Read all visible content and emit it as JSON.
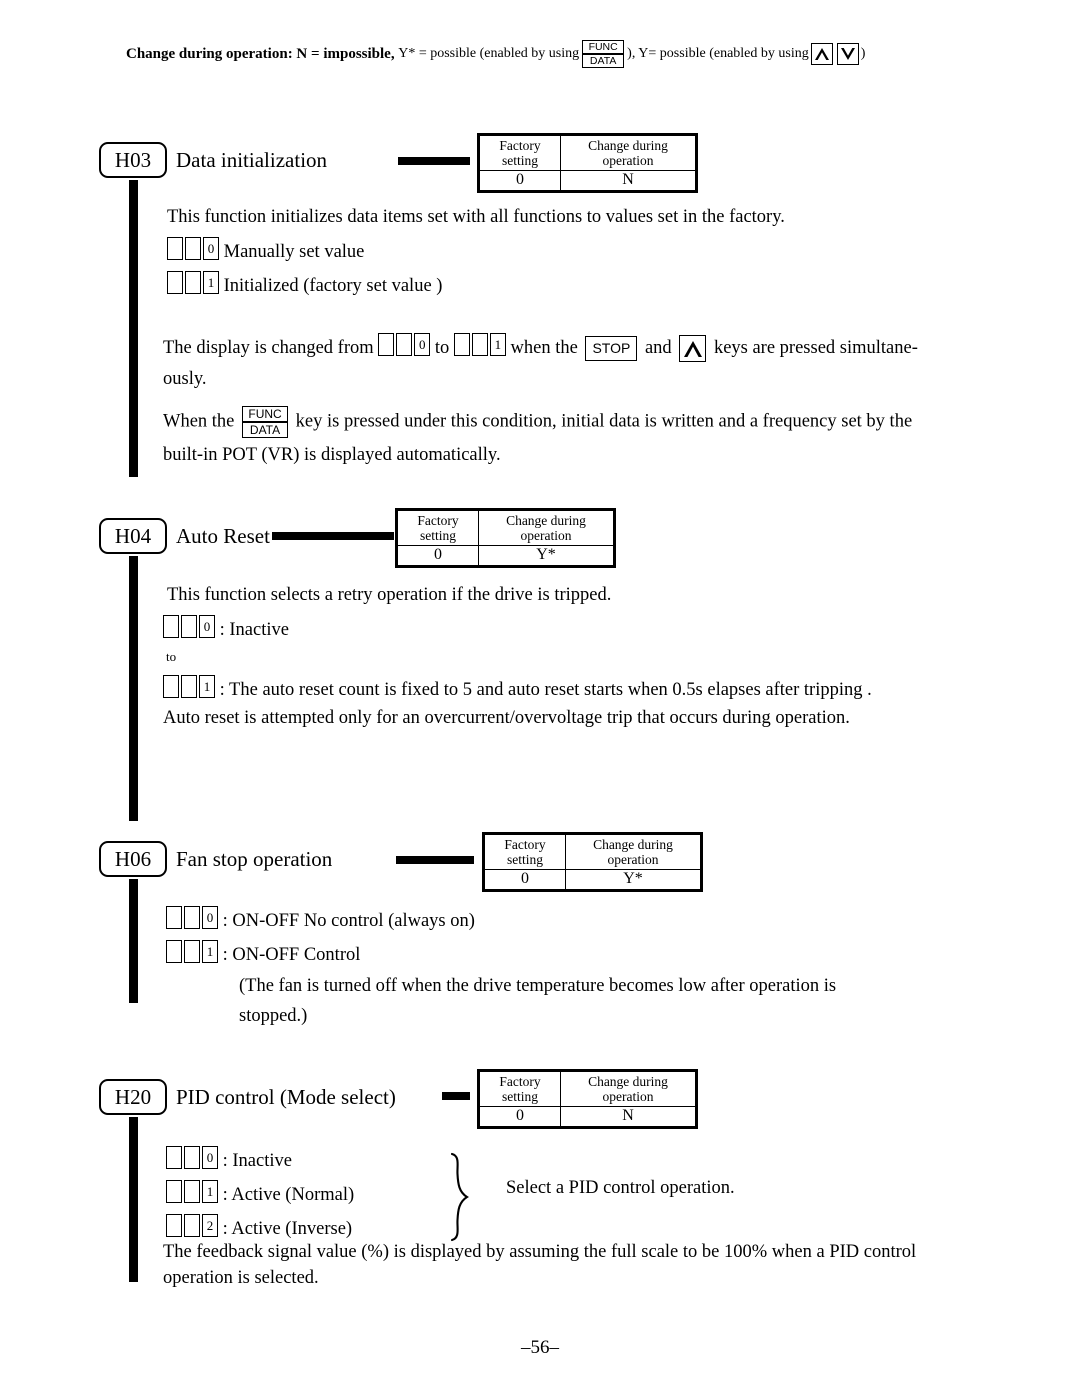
{
  "header": {
    "prefix_bold": "Change during operation: N = impossible,",
    "y_star_text": "Y* = possible (enabled by using",
    "func_key_top": "FUNC",
    "func_key_bottom": "DATA",
    "mid_text": "), Y= possible (enabled by using",
    "close_paren": ")"
  },
  "sections": [
    {
      "code": "H03",
      "title": "Data initialization",
      "table": {
        "header_col1": "Factory setting",
        "header_col1_line1": "Factory",
        "header_col1_line2": "setting",
        "header_col2_line1": "Change during",
        "header_col2_line2": "operation",
        "value_col1": "0",
        "value_col2": "N"
      },
      "intro": "This function initializes data items set with all functions to values set in the factory.",
      "options": [
        {
          "digit": "0",
          "label": "Manually set value"
        },
        {
          "digit": "1",
          "label": "Initialized (factory set value )"
        }
      ],
      "display_change": {
        "pre": "The display is changed from",
        "from_digit": "0",
        "mid": "to",
        "to_digit": "1",
        "post": "when the",
        "stop_key": "STOP",
        "post2": "and",
        "post3": "keys are pressed simultane-",
        "line2": "ously."
      },
      "func_para": {
        "pre": "When the",
        "key_top": "FUNC",
        "key_bottom": "DATA",
        "post": "key is pressed under this condition, initial data is written and a frequency set by the",
        "line2": "built-in POT (VR) is displayed automatically."
      }
    },
    {
      "code": "H04",
      "title": "Auto Reset",
      "table": {
        "header_col1_line1": "Factory",
        "header_col1_line2": "setting",
        "header_col2_line1": "Change during",
        "header_col2_line2": "operation",
        "value_col1": "0",
        "value_col2": "Y*"
      },
      "intro": "This function selects a retry operation if the drive is tripped.",
      "options": [
        {
          "digit": "0",
          "label": ": Inactive"
        },
        {
          "digit": "1",
          "label": ": The auto reset count is fixed to 5 and auto reset starts when 0.5s elapses after tripping ."
        }
      ],
      "to_label": "to",
      "footer": "Auto reset is attempted only for an overcurrent/overvoltage trip that occurs during operation."
    },
    {
      "code": "H06",
      "title": "Fan stop operation",
      "table": {
        "header_col1_line1": "Factory",
        "header_col1_line2": "setting",
        "header_col2_line1": "Change during",
        "header_col2_line2": "operation",
        "value_col1": "0",
        "value_col2": "Y*"
      },
      "options": [
        {
          "digit": "0",
          "label": ": ON-OFF No control (always on)"
        },
        {
          "digit": "1",
          "label": ": ON-OFF Control"
        }
      ],
      "note_line1": "(The fan is turned off when the drive temperature becomes low after operation is",
      "note_line2": "stopped.)"
    },
    {
      "code": "H20",
      "title": "PID control (Mode select)",
      "table": {
        "header_col1_line1": "Factory",
        "header_col1_line2": "setting",
        "header_col2_line1": "Change during",
        "header_col2_line2": "operation",
        "value_col1": "0",
        "value_col2": "N"
      },
      "options": [
        {
          "digit": "0",
          "label": ": Inactive"
        },
        {
          "digit": "1",
          "label": ": Active (Normal)"
        },
        {
          "digit": "2",
          "label": ": Active (Inverse)"
        }
      ],
      "brace_label": "Select a PID control operation.",
      "footer_line1": "The feedback signal value (%) is displayed by assuming the full scale to be 100% when a PID control",
      "footer_line2": "operation is selected."
    }
  ],
  "page_number": "–56–"
}
